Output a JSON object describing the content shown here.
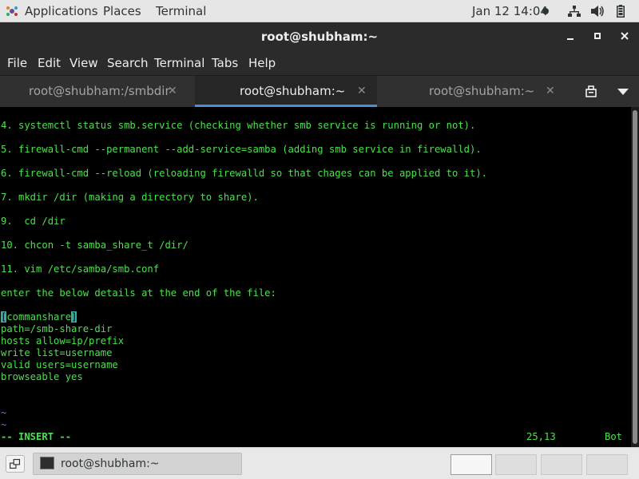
{
  "topbar": {
    "applications": "Applications",
    "places": "Places",
    "terminal": "Terminal",
    "clock": "Jan 12  14:04",
    "icons": [
      "applications-icon",
      "recording-dot-icon",
      "network-icon",
      "volume-icon",
      "battery-icon"
    ]
  },
  "window": {
    "title": "root@shubham:~",
    "buttons": [
      "minimize",
      "maximize",
      "close"
    ]
  },
  "menubar": {
    "items": [
      "File",
      "Edit",
      "View",
      "Search",
      "Terminal",
      "Tabs",
      "Help"
    ]
  },
  "tabs": [
    {
      "label": "root@shubham:/smbdir",
      "active": false
    },
    {
      "label": "root@shubham:~",
      "active": true
    },
    {
      "label": "root@shubham:~",
      "active": false
    }
  ],
  "terminal": {
    "lines": [
      "4. systemctl status smb.service (checking whether smb service is running or not).",
      "",
      "5. firewall-cmd --permanent --add-service=samba (adding smb service in firewalld).",
      "",
      "6. firewall-cmd --reload (reloading firewalld so that chages can be applied to it).",
      "",
      "7. mkdir /dir (making a directory to share).",
      "",
      "9.  cd /dir",
      "",
      "10. chcon -t samba_share_t /dir/",
      "",
      "11. vim /etc/samba/smb.conf",
      "",
      "enter the below details at the end of the file:",
      ""
    ],
    "share_block": {
      "cursor_char": "[",
      "header_rest": "commanshare",
      "closing_bracket": "]",
      "lines": [
        "path=/smb-share-dir",
        "hosts allow=ip/prefix",
        "write list=username",
        "valid users=username",
        "browseable yes"
      ]
    },
    "tildes": [
      "~",
      "~"
    ],
    "mode": "-- INSERT --",
    "position": "25,13",
    "scroll": "Bot"
  },
  "taskbar": {
    "task_label": "root@shubham:~",
    "workspaces": 4,
    "active_workspace": 1
  },
  "colors": {
    "terminal_text": "#4de04d",
    "terminal_bg": "#000000",
    "tilde": "#6c6cd8",
    "cursor": "#36b0a0",
    "active_tab_underline": "#4a90d9"
  }
}
